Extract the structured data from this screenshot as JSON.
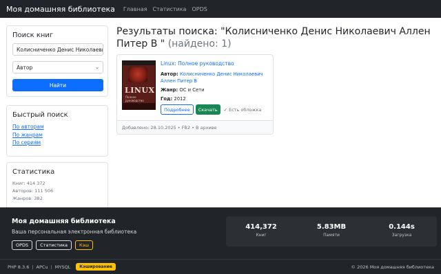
{
  "navbar": {
    "brand": "Моя домашняя библиотека",
    "links": [
      "Главная",
      "Статистика",
      "OPDS"
    ]
  },
  "search": {
    "title": "Поиск книг",
    "query": "Колисниченко Денис Николаевич",
    "type": "Автор",
    "button": "Найти"
  },
  "quick": {
    "title": "Быстрый поиск",
    "links": [
      "По авторам",
      "По жанрам",
      "По сериям"
    ]
  },
  "stats": {
    "title": "Статистика",
    "books": "Книг: 414 372",
    "authors": "Авторов: 111 506",
    "genres": "Жанров: 382"
  },
  "results": {
    "title": "Результаты поиска: \"Колисниченко Денис Николаевич Аллен Питер В \"",
    "count": "(найдено: 1)"
  },
  "book": {
    "title": "Linux: Полное руководство",
    "author_label": "Автор:",
    "author": "Колисниченко Денис Николаевич Аллен Питер В",
    "genre_label": "Жанр:",
    "genre": "ОС и Сети",
    "year_label": "Год:",
    "year": "2012",
    "details_button": "Подробнее",
    "download_button": "Скачать",
    "has_cover": "Есть обложка",
    "footer": "Добавлено: 28.10.2025 • FB2 • В архиве",
    "cover_text": "LINUX",
    "cover_subtitle": "Полное руководство"
  },
  "footer": {
    "title": "Моя домашняя библиотека",
    "description": "Ваша персональная электронная библиотека",
    "buttons": [
      "OPDS",
      "Статистика",
      "Кэш"
    ],
    "metrics": [
      {
        "value": "414,372",
        "label": "Книг"
      },
      {
        "value": "5.83MB",
        "label": "Памяти"
      },
      {
        "value": "0.144s",
        "label": "Загрузка"
      }
    ]
  },
  "bottombar": {
    "php": "PHP 8.3.6",
    "apcu": "APCu",
    "mysql": "MYSQL",
    "badge": "Кэширование",
    "copyright": "© 2026 Моя домашняя библиотека"
  },
  "colors": {
    "primary": "#0d6efd",
    "success": "#198754",
    "warning": "#ffc107",
    "dark": "#212529"
  }
}
